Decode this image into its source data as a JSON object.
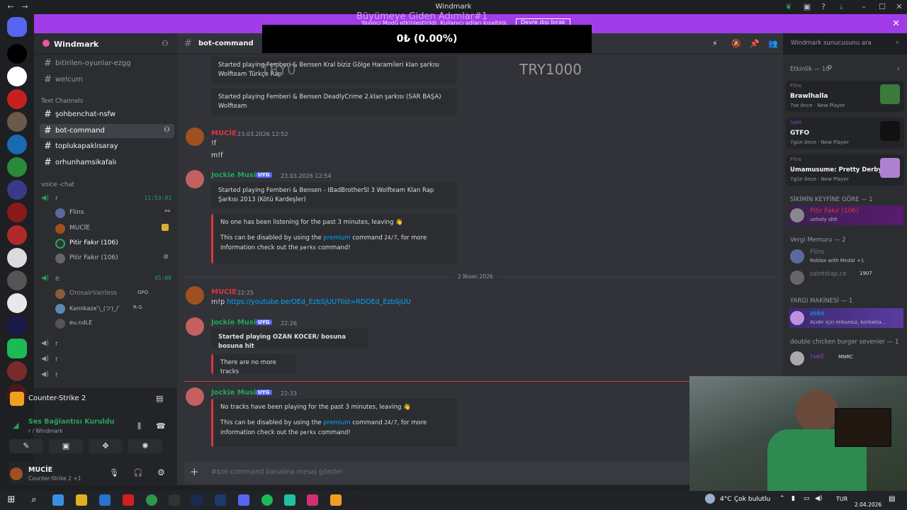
{
  "window": {
    "title": "Windmark"
  },
  "banner": {
    "overlay": "Büyümeye Giden Adımlar#1",
    "text": "Yayıncı Modu etkinleştirildi. Kullanıcı adları kısaltıldı.",
    "button": "Devre dışı bırak"
  },
  "ticker": {
    "value": "0₺ (0.00%)",
    "left_label": "TRY0",
    "right_label": "TRY1000"
  },
  "server": {
    "name": "Windmark"
  },
  "channels": {
    "top": [
      {
        "label": "bitirilen-oyunlar-ezgg"
      },
      {
        "label": "welcum"
      }
    ],
    "text_category": "Text Channels",
    "text": [
      {
        "label": "şohbenchat-nsfw"
      },
      {
        "label": "bot-command"
      },
      {
        "label": "toplukapaklısaray"
      },
      {
        "label": "orhunhamsikafalı"
      }
    ],
    "voice_category": "voice -chat",
    "voice": [
      {
        "label": "r",
        "timer": "11:53:03",
        "users": [
          {
            "name": "Flins"
          },
          {
            "name": "MUCİE"
          },
          {
            "name": "Pitir Fakır (106)"
          },
          {
            "name": "Pitir Fakır (106)"
          }
        ]
      },
      {
        "label": "e",
        "timer": "45:00",
        "users": [
          {
            "name": "OrosairVairless",
            "badge": "GPO"
          },
          {
            "name": "Kamikaze ̄\\_(ツ)_/ ̄",
            "badge": "R-G"
          },
          {
            "name": "eu.ndLE"
          }
        ]
      },
      {
        "label": "r"
      },
      {
        "label": "r"
      },
      {
        "label": "r"
      }
    ]
  },
  "activity": {
    "game": "Counter-Strike 2"
  },
  "voice_status": {
    "title": "Ses Bağlantısı Kuruldu",
    "subtitle": "r / Windmark"
  },
  "user": {
    "name": "MUCİE",
    "status": "Counter-Strike 2 +1"
  },
  "chat": {
    "channel": "bot-command",
    "search_placeholder": "Windmark sunucusunu ara",
    "input_placeholder": "#bot-command kanalına mesaj gönder",
    "messages": [
      {
        "embed1": "Started playing Femberi & Bensen Kral biziz Gölge Haramileri klan şarkısı Wolfteam Türkçe Rap",
        "embed2": "Started playing Femberi & Bensen DeadlyCrime 2.klan şarkısı (SAR BAŞA) Wolfteam"
      },
      {
        "author": "MUCİE",
        "time": "23.03.2026 12:52",
        "line1": "!f",
        "line2": "m!f"
      },
      {
        "author": "Jockie Music",
        "tag": "UYG",
        "time": "23.03.2026 12:54",
        "embed": "Started playing Femberi & Bensen - IBadBrotherSl 3 Wolfteam Klan Rap Şarkısı 2013 (Kötü Kardeşler)",
        "warn1": "No one has been listening for the past 3 minutes, leaving 👋",
        "warn2a": "This can be disabled by using the ",
        "warn2b": "premium",
        "warn2c": " command ",
        "warn2d": "24/7",
        "warn2e": ", for more information check out the ",
        "warn2f": "perks",
        "warn2g": " command!"
      },
      {
        "divider": "2 Nisan 2026"
      },
      {
        "author": "MUCİE",
        "time": "22:25",
        "prefix": "m!p ",
        "link": "https://youtube.be/OEd_EzbSjUU?list=RDOEd_EzbSjUU"
      },
      {
        "author": "Jockie Music",
        "tag": "UYG",
        "time": "22:26",
        "embed": "Started playing OZAN KOCER/ bosuna bosuna hit",
        "warn": "There are no more tracks"
      },
      {
        "author": "Jockie Music",
        "tag": "UYG",
        "time": "22:33",
        "warn1": "No tracks have been playing for the past 3 minutes, leaving 👋",
        "warn2a": "This can be disabled by using the ",
        "warn2b": "premium",
        "warn2c": " command ",
        "warn2d": "24/7",
        "warn2e": ", for more information check out the ",
        "warn2f": "perks",
        "warn2g": " command!"
      }
    ]
  },
  "members": {
    "activity_header": "Etkinlik — 10",
    "activities": [
      {
        "user": "Flins",
        "game": "Brawlhalla",
        "time": "7se önce",
        "tag": "New Player"
      },
      {
        "user": "!veil.",
        "game": "GTFO",
        "time": "7gün önce",
        "tag": "New Player"
      },
      {
        "user": "Flins",
        "game": "Umamusume: Pretty Derby",
        "time": "7gün önce",
        "tag": "New Player"
      }
    ],
    "groups": [
      {
        "header": "SİKİMİN KEYFİNE GÖRE — 1",
        "members": [
          {
            "name": "Pitir Fakır (106)",
            "sub": "unholy shit"
          }
        ]
      },
      {
        "header": "Vergi Memuru — 2",
        "members": [
          {
            "name": "Flins",
            "sub": "Roblox with Medal +1"
          },
          {
            "name": "saintstap.ce",
            "badge": "1907"
          }
        ]
      },
      {
        "header": "YARGI MAKİNESİ — 1",
        "members": [
          {
            "name": "zeke",
            "sub": "Acıdır için imkansız, korkakla..."
          }
        ]
      },
      {
        "header": "double chicken burger sevenler — 1",
        "members": [
          {
            "name": "!veil.",
            "badge": "MNRC"
          }
        ]
      }
    ]
  },
  "taskbar": {
    "weather": "4°C",
    "weather_text": "Çok bulutlu",
    "lang": "TUR",
    "date": "2.04.2026"
  },
  "colors": {
    "accent": "#5865f2",
    "banner": "#a03ce8",
    "online": "#23a55a",
    "danger": "#da373c",
    "link": "#00a8fc"
  }
}
